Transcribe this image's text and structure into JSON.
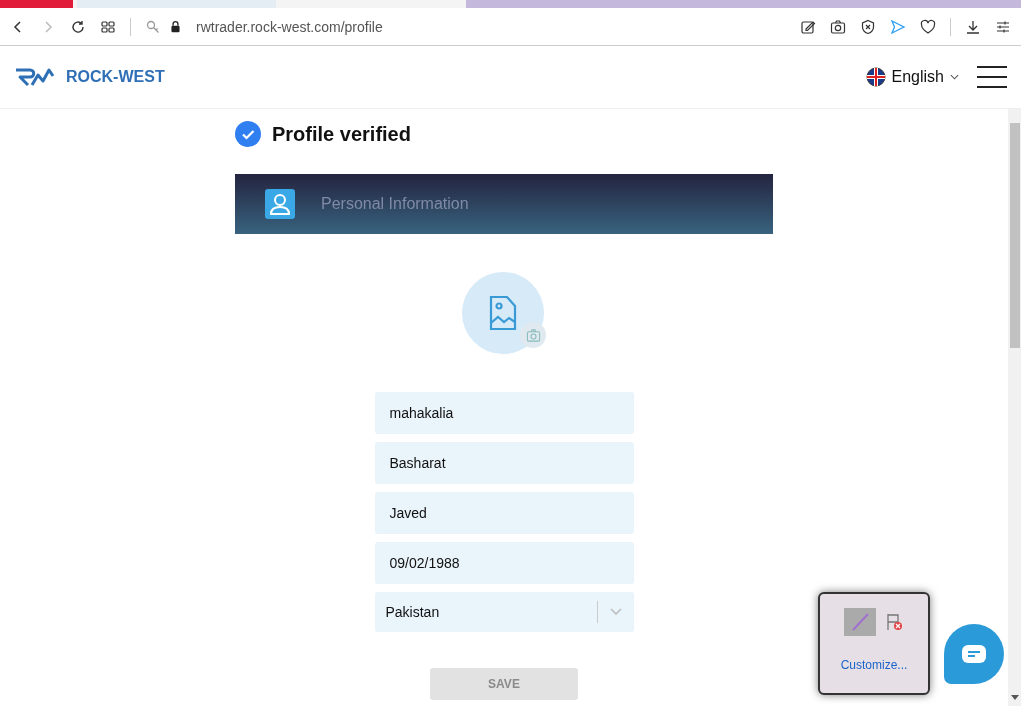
{
  "browser": {
    "url": "rwtrader.rock-west.com/profile"
  },
  "header": {
    "logo_text": "ROCK-WEST",
    "language": "English"
  },
  "verified": {
    "label": "Profile verified",
    "checked": true
  },
  "section": {
    "title": "Personal Information"
  },
  "fields": [
    {
      "kind": "text",
      "value": "mahakalia"
    },
    {
      "kind": "text",
      "value": "Basharat"
    },
    {
      "kind": "text",
      "value": "Javed"
    },
    {
      "kind": "text",
      "value": "09/02/1988"
    },
    {
      "kind": "select",
      "value": "Pakistan"
    }
  ],
  "save_button": {
    "label": "SAVE",
    "disabled": true
  },
  "popup": {
    "link": "Customize..."
  }
}
